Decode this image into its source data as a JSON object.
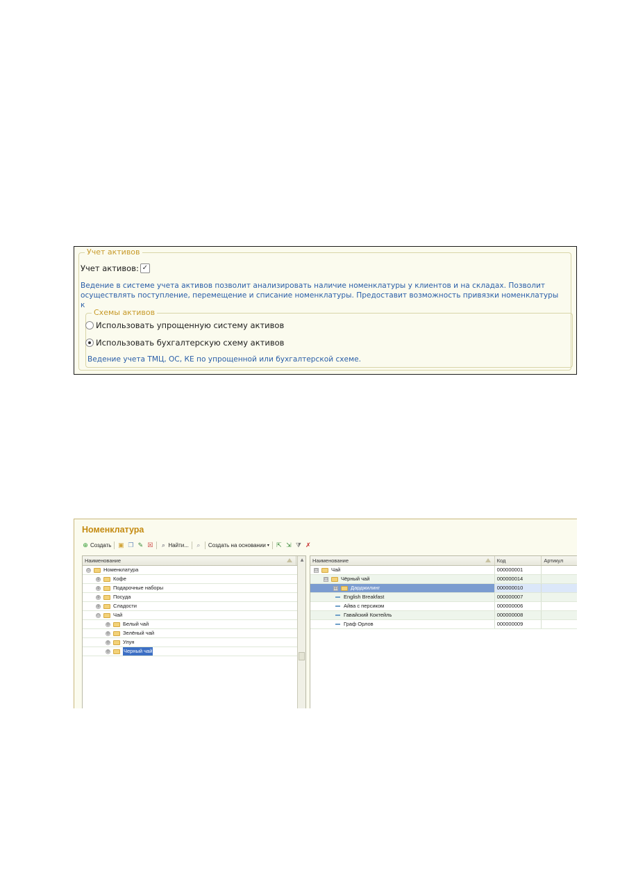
{
  "assets": {
    "group_title": "Учет активов",
    "checkbox_label": "Учет активов:",
    "checkbox_checked": true,
    "description_line1": "Ведение в системе учета активов позволит анализировать наличие номенклатуры у клиентов и на складах. Позволит",
    "description_line2": "осуществлять поступление, перемещение и списание номенклатуры. Предоставит возможность привязки номенклатуры к",
    "schemes": {
      "group_title": "Схемы активов",
      "options": [
        {
          "label": "Использовать упрощенную систему активов",
          "selected": false
        },
        {
          "label": "Использовать бухгалтерскую схему активов",
          "selected": true
        }
      ],
      "note": "Ведение учета ТМЦ, ОС, КЕ по упрощенной или бухгалтерской схеме."
    }
  },
  "nomenclature": {
    "title": "Номенклатура",
    "toolbar": {
      "create": "Создать",
      "find": "Найти...",
      "create_based": "Создать на основании"
    },
    "left_pane": {
      "header": "Наименование",
      "rows": [
        {
          "label": "Номенклатура",
          "level": 0,
          "expander": "⊖"
        },
        {
          "label": "Кофе",
          "level": 1,
          "expander": "⊕"
        },
        {
          "label": "Подарочные наборы",
          "level": 1,
          "expander": "⊕"
        },
        {
          "label": "Посуда",
          "level": 1,
          "expander": "⊕"
        },
        {
          "label": "Сладости",
          "level": 1,
          "expander": "⊕"
        },
        {
          "label": "Чай",
          "level": 1,
          "expander": "⊖"
        },
        {
          "label": "Белый чай",
          "level": 2,
          "expander": "⊕"
        },
        {
          "label": "Зелёный чай",
          "level": 2,
          "expander": "⊕"
        },
        {
          "label": "Улун",
          "level": 2,
          "expander": "⊕"
        },
        {
          "label": "Черный чай",
          "level": 2,
          "expander": "⊕",
          "selected": true
        }
      ]
    },
    "right_pane": {
      "columns": [
        "Наименование",
        "Код",
        "Артикул"
      ],
      "rows": [
        {
          "name": "Чай",
          "code": "000000001",
          "article": "",
          "level": 0,
          "kind": "folder",
          "expander": "⊟"
        },
        {
          "name": "Чёрный чай",
          "code": "000000014",
          "article": "",
          "level": 1,
          "kind": "folder",
          "expander": "⊟"
        },
        {
          "name": "Дарджилинг",
          "code": "000000010",
          "article": "",
          "level": 2,
          "kind": "folder",
          "expander": "⊞",
          "selected": true
        },
        {
          "name": "English Breakfast",
          "code": "000000007",
          "article": "",
          "level": 2,
          "kind": "item"
        },
        {
          "name": "Айва с персиком",
          "code": "000000006",
          "article": "",
          "level": 2,
          "kind": "item"
        },
        {
          "name": "Гавайский Коктейль",
          "code": "000000008",
          "article": "",
          "level": 2,
          "kind": "item"
        },
        {
          "name": "Граф Орлов",
          "code": "000000009",
          "article": "",
          "level": 2,
          "kind": "item"
        }
      ]
    }
  }
}
